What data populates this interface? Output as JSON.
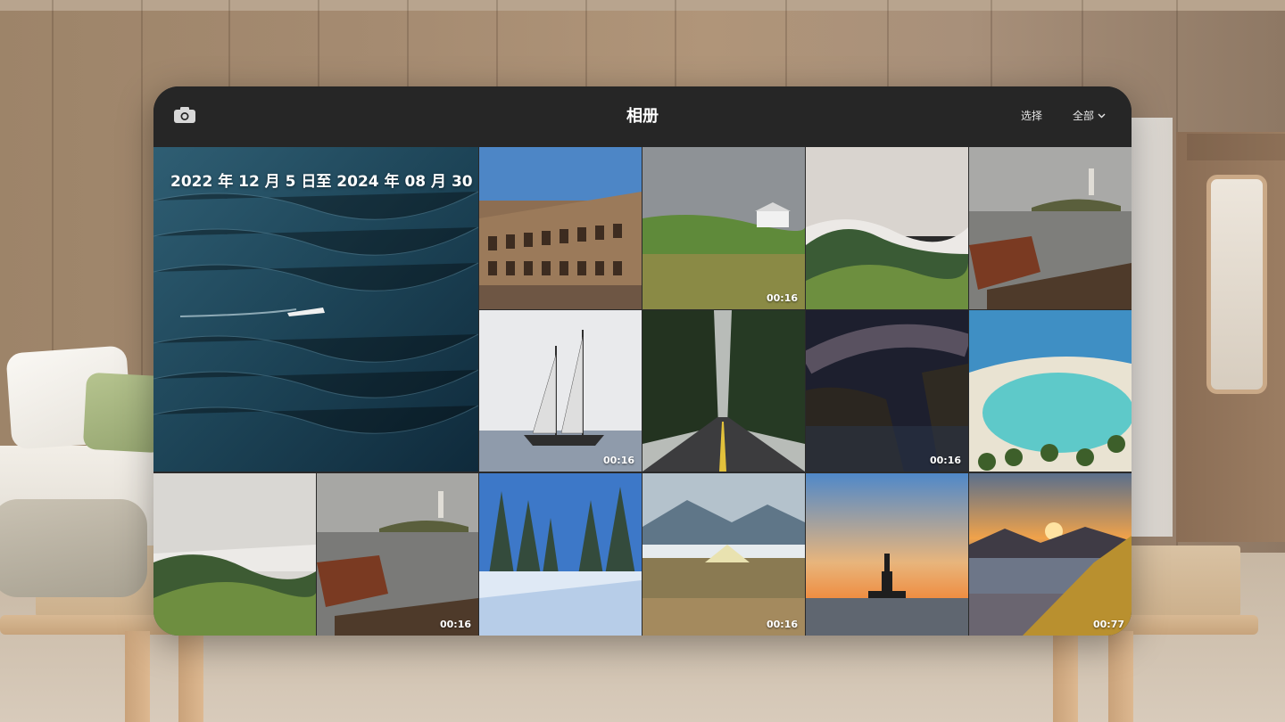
{
  "header": {
    "title": "相册",
    "select_label": "选择",
    "filter_label": "全部",
    "camera_icon": "camera-icon",
    "chevron_icon": "chevron-down-icon"
  },
  "featured": {
    "date_range": "2022 年 12 月 5 日至 2024 年 08 月 30 日"
  },
  "photos": [
    {
      "subject": "colosseum",
      "duration": ""
    },
    {
      "subject": "green-hill-house",
      "duration": "00:16"
    },
    {
      "subject": "foggy-hills",
      "duration": ""
    },
    {
      "subject": "lake-boat-island-church",
      "duration": ""
    },
    {
      "subject": "sailing-ship",
      "duration": "00:16"
    },
    {
      "subject": "forest-road",
      "duration": ""
    },
    {
      "subject": "milky-way-cliff",
      "duration": "00:16"
    },
    {
      "subject": "tropical-beach",
      "duration": ""
    },
    {
      "subject": "foggy-hills",
      "duration": ""
    },
    {
      "subject": "lake-boat-island-church",
      "duration": "00:16"
    },
    {
      "subject": "snowy-forest",
      "duration": ""
    },
    {
      "subject": "mountain-tent",
      "duration": "00:16"
    },
    {
      "subject": "statue-of-liberty-sunset",
      "duration": ""
    },
    {
      "subject": "fjord-sunset",
      "duration": "00:77"
    }
  ],
  "colors": {
    "window_bg": "#262626",
    "text": "#ffffff"
  }
}
